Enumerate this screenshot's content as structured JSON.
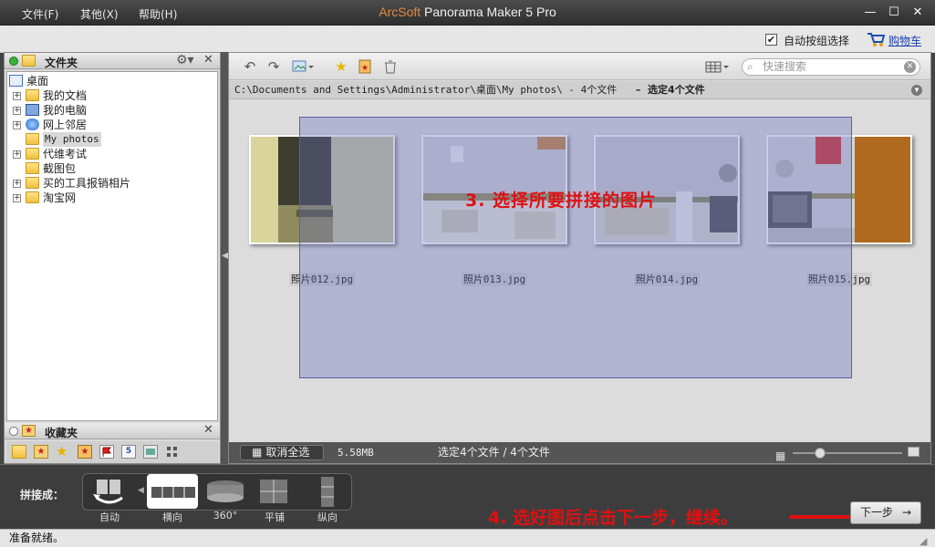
{
  "menu": {
    "file": "文件(F)",
    "other": "其他(X)",
    "help": "帮助(H)"
  },
  "app": {
    "brand": "ArcSoft",
    "name": " Panorama Maker 5 Pro"
  },
  "window": {
    "minimize": "—",
    "maximize": "☐",
    "close": "✕"
  },
  "topbar": {
    "auto_group_label": "自动按组选择",
    "auto_group_checked": true,
    "cart_label": "购物车"
  },
  "folders": {
    "header": "文件夹",
    "items": [
      {
        "label": "桌面",
        "indent": 0,
        "expand": "",
        "icon": "desktop-icon"
      },
      {
        "label": "我的文档",
        "indent": 1,
        "expand": "+",
        "icon": "folder-icon"
      },
      {
        "label": "我的电脑",
        "indent": 1,
        "expand": "+",
        "icon": "computer-icon"
      },
      {
        "label": "网上邻居",
        "indent": 1,
        "expand": "+",
        "icon": "network-icon"
      },
      {
        "label": "My photos",
        "indent": 1,
        "expand": "",
        "icon": "folder-icon",
        "selected": true
      },
      {
        "label": "代维考试",
        "indent": 1,
        "expand": "+",
        "icon": "folder-icon"
      },
      {
        "label": "截图包",
        "indent": 1,
        "expand": "",
        "icon": "folder-icon"
      },
      {
        "label": "买的工具报销相片",
        "indent": 1,
        "expand": "+",
        "icon": "folder-icon"
      },
      {
        "label": "淘宝网",
        "indent": 1,
        "expand": "+",
        "icon": "folder-icon"
      }
    ]
  },
  "favorites": {
    "header": "收藏夹"
  },
  "toolbar": {
    "search_placeholder": "快速搜索"
  },
  "path": {
    "text": "C:\\Documents and Settings\\Administrator\\桌面\\My photos\\ - 4个文件",
    "selection": "选定4个文件"
  },
  "photos": [
    {
      "name": "照片012.jpg"
    },
    {
      "name": "照片013.jpg"
    },
    {
      "name": "照片014.jpg"
    },
    {
      "name": "照片015.jpg"
    }
  ],
  "annotations": {
    "step3": "3. 选择所要拼接的图片",
    "step4": "4. 选好图后点击下一步，继续。"
  },
  "status": {
    "unselect_all": "取消全选",
    "size": "5.58MB",
    "count": "选定4个文件 / 4个文件",
    "zoom_fraction": 0.25
  },
  "stitch": {
    "label": "拼接成：",
    "modes": [
      {
        "label": "自动"
      },
      {
        "label": "横向",
        "selected": true
      },
      {
        "label": "360°"
      },
      {
        "label": "平铺"
      },
      {
        "label": "纵向"
      }
    ],
    "next": "下一步"
  },
  "statusline": {
    "text": "准备就绪。"
  }
}
